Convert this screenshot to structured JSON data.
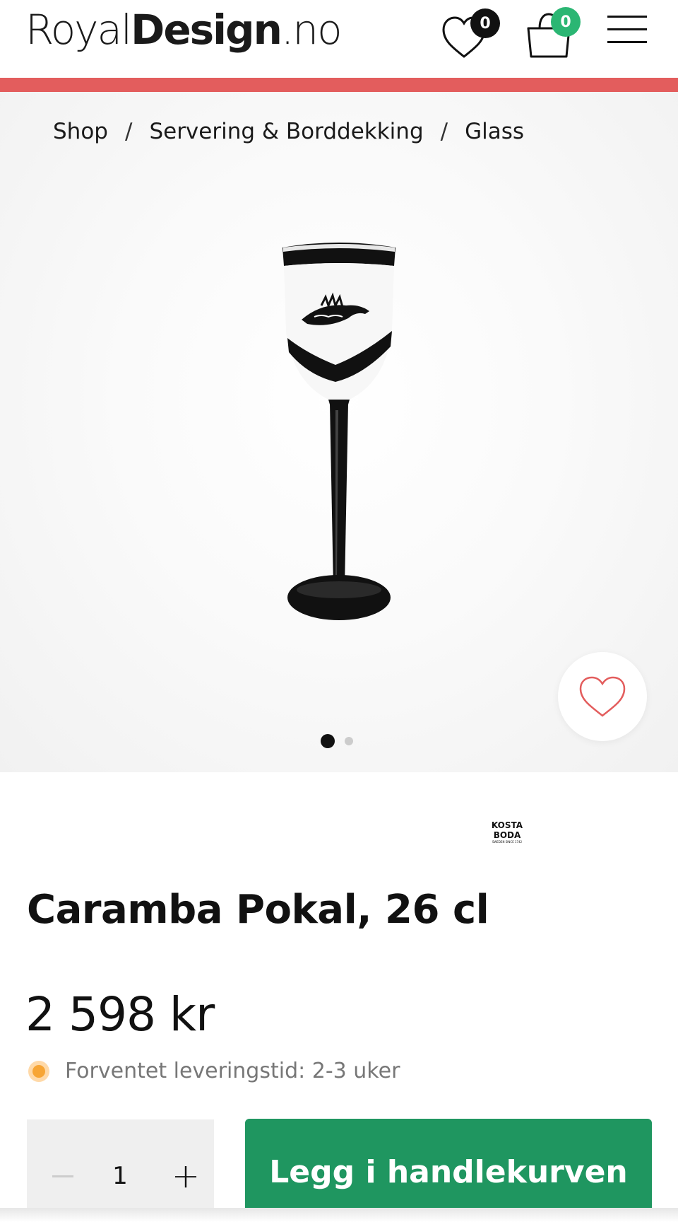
{
  "header": {
    "logo": {
      "part1": "Royal",
      "part2": "Design",
      "part3": ".no"
    },
    "wishlist_count": "0",
    "cart_count": "0",
    "colors": {
      "accent_bar": "#e35d5d",
      "cart_badge": "#2bb673",
      "wishlist_badge": "#111111"
    }
  },
  "breadcrumb": {
    "items": [
      "Shop",
      "Servering & Borddekking",
      "Glass"
    ],
    "separator": "/"
  },
  "gallery": {
    "image_count": 2,
    "active_index": 0,
    "icon": "heart-outline-icon"
  },
  "product": {
    "brand_logo_line1": "KOSTA",
    "brand_logo_line2": "BODA",
    "brand_logo_tagline": "SWEDEN SINCE 1742",
    "title": "Caramba Pokal, 26 cl",
    "price": "2 598 kr",
    "delivery_text": "Forventet leveringstid: 2-3 uker",
    "delivery_status_color": "#f7a535"
  },
  "purchase": {
    "quantity": "1",
    "minus_symbol": "−",
    "plus_symbol": "+",
    "add_to_cart_label": "Legg i handlekurven",
    "button_color": "#1f9660"
  }
}
